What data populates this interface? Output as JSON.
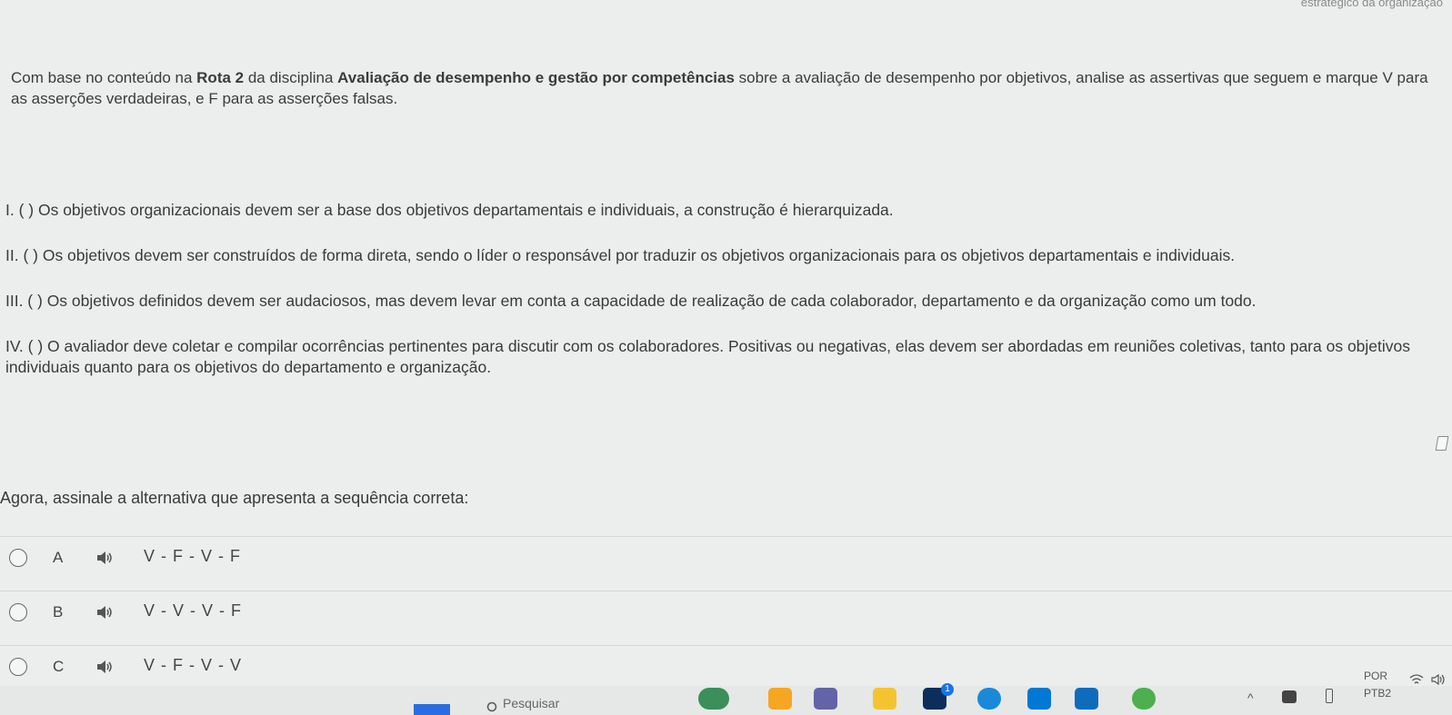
{
  "top_fragment": "estratégico da organização",
  "intro": {
    "p1": "Com base no conteúdo na ",
    "b1": "Rota 2",
    "p2": " da disciplina ",
    "b2": "Avaliação de desempenho e gestão por competências",
    "p3": " sobre a avaliação de desempenho por objetivos, analise as assertivas que seguem e marque V para as asserções verdadeiras, e F para as asserções falsas."
  },
  "assertions": [
    "I. ( ) Os objetivos organizacionais devem ser a base dos objetivos departamentais e individuais, a construção é hierarquizada.",
    "II. ( ) Os objetivos devem ser construídos de forma direta, sendo o líder o responsável por traduzir os objetivos organizacionais para os objetivos departamentais e individuais.",
    "III. (  ) Os objetivos definidos devem ser audaciosos, mas devem levar em conta a capacidade de realização de cada colaborador, departamento e da organização como um todo.",
    "IV. ( ) O avaliador deve coletar e compilar ocorrências pertinentes para discutir com os colaboradores. Positivas ou negativas, elas devem ser abordadas em reuniões coletivas, tanto para os objetivos individuais quanto para os objetivos do departamento e organização."
  ],
  "prompt": "Agora, assinale a alternativa que apresenta a sequência correta:",
  "options": [
    {
      "letter": "A",
      "text": "V - F - V - F"
    },
    {
      "letter": "B",
      "text": "V - V - V - F"
    },
    {
      "letter": "C",
      "text": "V - F - V - V"
    }
  ],
  "taskbar": {
    "search_placeholder": "Pesquisar",
    "lang1": "POR",
    "lang2": "PTB2",
    "badge1": "1",
    "icon_colors": [
      "#2b6de0",
      "#f6a623",
      "#6264a7",
      "#f4c430",
      "#1a73e8",
      "#0078d4",
      "#e44d26",
      "#4caf50"
    ]
  }
}
